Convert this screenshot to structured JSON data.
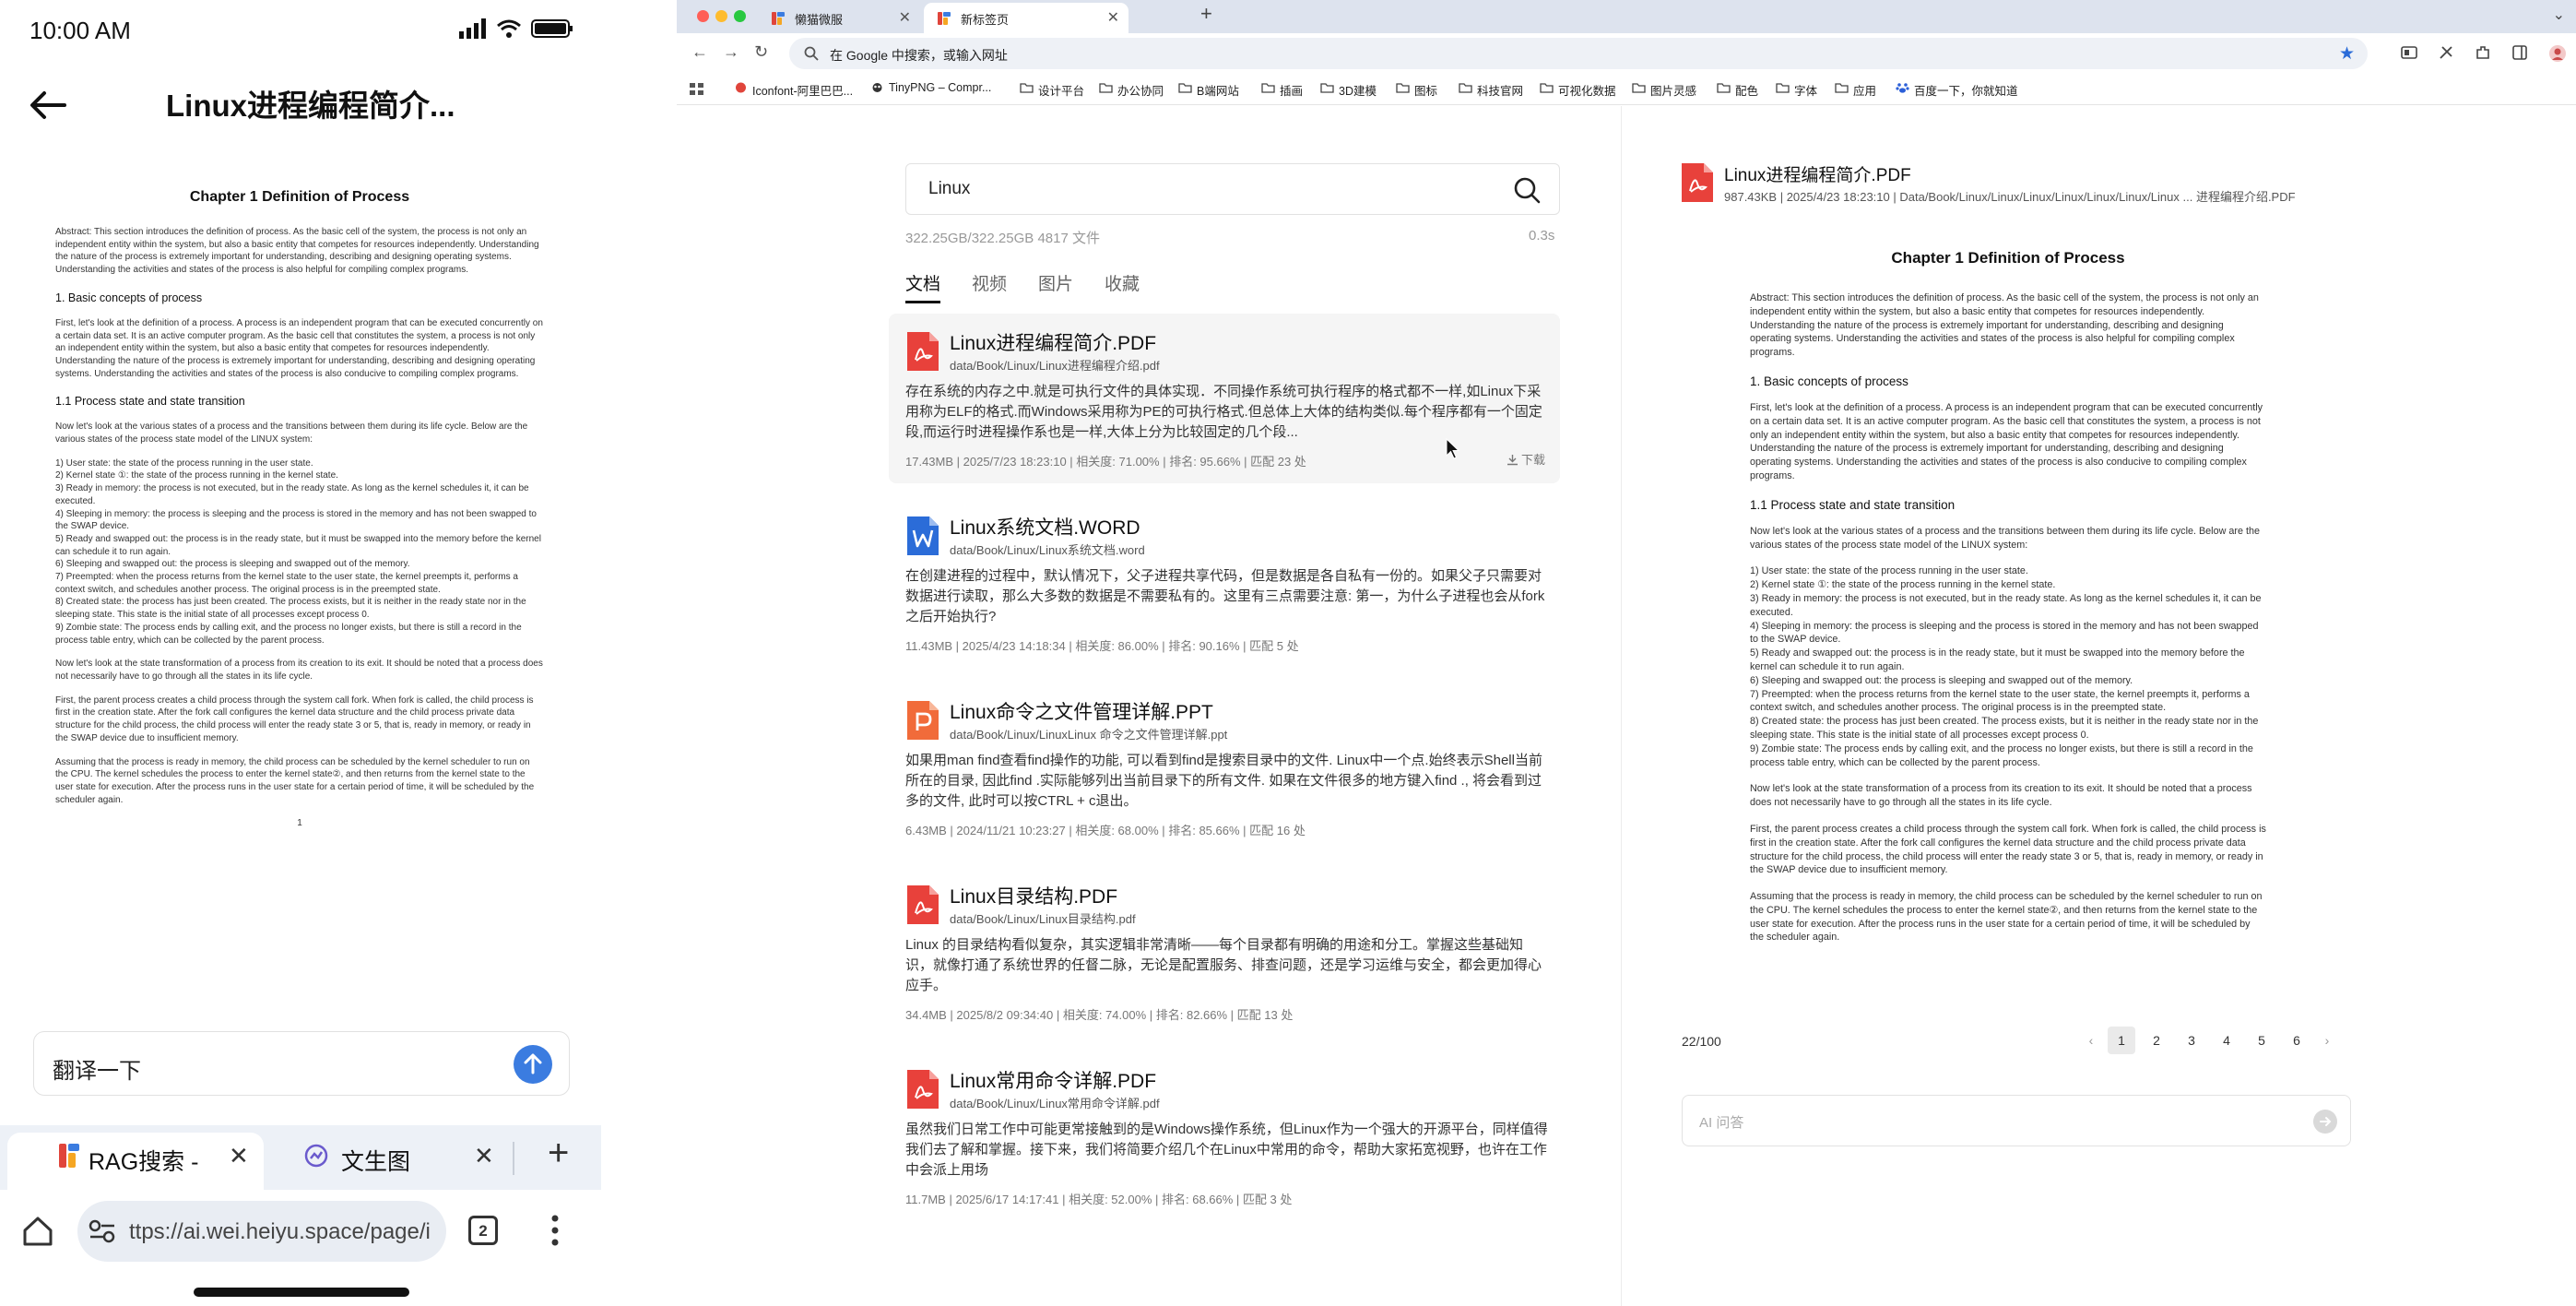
{
  "mobile": {
    "status": {
      "time": "10:00 AM"
    },
    "header": {
      "title": "Linux进程编程简介..."
    },
    "input": {
      "value": "翻译一下"
    },
    "tabs": [
      {
        "label": "RAG搜索 - ⁣",
        "close": "✕"
      },
      {
        "label": "文生图",
        "close": "✕"
      }
    ],
    "new_tab": "+",
    "tab_count": "2",
    "url": "ttps://ai.wei.heiyu.space/page/i"
  },
  "document": {
    "title": "Chapter 1 Definition of Process",
    "abstract": "Abstract: This section introduces the definition of process. As the basic cell of the system, the process is not only an independent entity within the system, but also a basic entity that competes for resources independently. Understanding the nature of the process is extremely important for understanding, describing and designing operating systems. Understanding the activities and states of the process is also helpful for compiling complex programs.",
    "sec1_title": "1. Basic concepts of process",
    "sec1_body": "First, let's look at the definition of a process. A process is an independent program that can be executed concurrently on a certain data set. It is an active computer program. As the basic cell that constitutes the system, a process is not only an independent entity within the system, but also a basic entity that competes for resources independently. Understanding the nature of the process is extremely important for understanding, describing and designing operating systems. Understanding the activities and states of the process is also conducive to compiling complex programs.",
    "sec11_title": "1.1 Process state and state transition",
    "sec11_intro": "Now let's look at the various states of a process and the transitions between them during its life cycle. Below are the various states of the process state model of the LINUX system:",
    "states": [
      "1) User state: the state of the process running in the user state.",
      "2) Kernel state ①: the state of the process running in the kernel state.",
      "3) Ready in memory: the process is not executed, but in the ready state. As long as the kernel schedules it, it can be executed.",
      "4) Sleeping in memory: the process is sleeping and the process is stored in the memory and has not been swapped to the SWAP device.",
      "5) Ready and swapped out: the process is in the ready state, but it must be swapped into the memory before the kernel can schedule it to run again.",
      "6) Sleeping and swapped out: the process is sleeping and swapped out of the memory.",
      "7) Preempted: when the process returns from the kernel state to the user state, the kernel preempts it, performs a context switch, and schedules another process. The original process is in the preempted state.",
      "8) Created state: the process has just been created. The process exists, but it is neither in the ready state nor in the sleeping state. This state is the initial state of all processes except process 0.",
      "9) Zombie state: The process ends by calling exit, and the process no longer exists, but there is still a record in the process table entry, which can be collected by the parent process."
    ],
    "para_transform": "Now let's look at the state transformation of a process from its creation to its exit. It should be noted that a process does not necessarily have to go through all the states in its life cycle.",
    "para_fork": "First, the parent process creates a child process through the system call fork. When fork is called, the child process is first in the creation state. After the fork call configures the kernel data structure and the child process private data structure for the child process, the child process will enter the ready state 3 or 5, that is, ready in memory, or ready in the SWAP device due to insufficient memory.",
    "para_sched": "Assuming that the process is ready in memory, the child process can be scheduled by the kernel scheduler to run on the CPU. The kernel schedules the process to enter the kernel state②, and then returns from the kernel state to the user state for execution. After the process runs in the user state for a certain period of time, it will be scheduled by the scheduler again.",
    "page_number": "1"
  },
  "browser": {
    "tabs": [
      {
        "label": "懒猫微服",
        "close": "✕"
      },
      {
        "label": "新标签页",
        "close": "✕"
      }
    ],
    "new_tab": "+",
    "omnibox": "在 Google 中搜索，或输入网址",
    "bookmarks": [
      "Iconfont-阿里巴巴...",
      "TinyPNG – Compr...",
      "设计平台",
      "办公协同",
      "B端网站",
      "插画",
      "3D建模",
      "图标",
      "科技官网",
      "可视化数据",
      "图片灵感",
      "配色",
      "字体",
      "应用",
      "百度一下，你就知道"
    ]
  },
  "search": {
    "query": "Linux",
    "stats": "322.25GB/322.25GB  4817 文件",
    "time": "0.3s",
    "categories": [
      "文档",
      "视频",
      "图片",
      "收藏"
    ],
    "results": [
      {
        "name": "Linux进程编程简介.PDF",
        "path": "data/Book/Linux/Linux进程编程介绍.pdf",
        "snippet": "存在系统的内存之中.就是可执行文件的具体实现．不同操作系统可执行程序的格式都不一样,如Linux下采用称为ELF的格式.而Windows采用称为PE的可执行格式.但总体上大体的结构类似.每个程序都有一个固定段,而运行时进程操作系也是一样,大体上分为比较固定的几个段...",
        "meta": "17.43MB  |  2025/7/23 18:23:10   |  相关度: 71.00%  |  排名: 95.66%  |  匹配 23 处",
        "download": "下载"
      },
      {
        "name": "Linux系统文档.WORD",
        "path": "data/Book/Linux/Linux系统文档.word",
        "snippet": "在创建进程的过程中，默认情况下，父子进程共享代码，但是数据是各自私有一份的。如果父子只需要对数据进行读取，那么大多数的数据是不需要私有的。这里有三点需要注意: 第一，为什么子进程也会从fork之后开始执行?",
        "meta": "11.43MB  |  2025/4/23 14:18:34   |  相关度: 86.00%  |  排名: 90.16%  |  匹配 5 处"
      },
      {
        "name": "Linux命令之文件管理详解.PPT",
        "path": "data/Book/Linux/LinuxLinux 命令之文件管理详解.ppt",
        "snippet": "如果用man find查看find操作的功能, 可以看到find是搜索目录中的文件. Linux中一个点.始终表示Shell当前所在的目录, 因此find .实际能够列出当前目录下的所有文件. 如果在文件很多的地方键入find ., 将会看到过多的文件, 此时可以按CTRL + c退出。",
        "meta": "6.43MB  |  2024/11/21 10:23:27   |  相关度: 68.00%  |  排名: 85.66%  |  匹配 16 处"
      },
      {
        "name": "Linux目录结构.PDF",
        "path": "data/Book/Linux/Linux目录结构.pdf",
        "snippet": "Linux 的目录结构看似复杂，其实逻辑非常清晰——每个目录都有明确的用途和分工。掌握这些基础知识，就像打通了系统世界的任督二脉，无论是配置服务、排查问题，还是学习运维与安全，都会更加得心应手。",
        "meta": "34.4MB  |  2025/8/2 09:34:40   |  相关度: 74.00%  |  排名: 82.66%  |  匹配 13 处"
      },
      {
        "name": "Linux常用命令详解.PDF",
        "path": "data/Book/Linux/Linux常用命令详解.pdf",
        "snippet": "虽然我们日常工作中可能更常接触到的是Windows操作系统，但Linux作为一个强大的开源平台，同样值得我们去了解和掌握。接下来，我们将简要介绍几个在Linux中常用的命令，帮助大家拓宽视野，也许在工作中会派上用场",
        "meta": "11.7MB  |  2025/6/17 14:17:41   |  相关度: 52.00%  |  排名: 68.66%  |  匹配 3 处"
      }
    ]
  },
  "preview": {
    "name": "Linux进程编程简介.PDF",
    "meta": "987.43KB  |  2025/4/23 18:23:10  |  Data/Book/Linux/Linux/Linux/Linux/Linux/Linux/Linux ... 进程编程介绍.PDF",
    "page_count": "22/100",
    "pages": [
      "1",
      "2",
      "3",
      "4",
      "5",
      "6"
    ],
    "prev": "‹",
    "next": "›",
    "ai_placeholder": "AI 问答"
  }
}
